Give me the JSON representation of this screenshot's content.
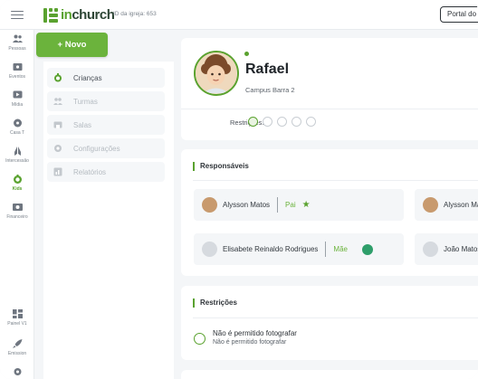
{
  "topbar": {
    "logo_text_green": "in",
    "logo_text_dark": "church",
    "church_id": "ID da igreja: 653",
    "portal_button": "Portal do Membro"
  },
  "rail": {
    "items": [
      {
        "label": "Pessoas",
        "icon": "people-icon"
      },
      {
        "label": "Eventos",
        "icon": "ticket-icon"
      },
      {
        "label": "Mídia",
        "icon": "play-icon"
      },
      {
        "label": "Casa T",
        "icon": "globe-icon"
      },
      {
        "label": "Intercessão",
        "icon": "praying-hands-icon"
      },
      {
        "label": "Kids",
        "icon": "kids-icon"
      },
      {
        "label": "Financeiro",
        "icon": "money-icon"
      },
      {
        "label": "Painel V1",
        "icon": "dashboard-icon"
      },
      {
        "label": "Emission",
        "icon": "rocket-icon"
      }
    ],
    "active": "Kids"
  },
  "actions": {
    "new_button": "+ Novo"
  },
  "submenu": {
    "items": [
      {
        "label": "Crianças"
      },
      {
        "label": "Turmas"
      },
      {
        "label": "Salas"
      },
      {
        "label": "Configurações"
      },
      {
        "label": "Relatórios"
      }
    ],
    "active": "Crianças"
  },
  "profile": {
    "name": "Rafael",
    "campus": "Campus Barra 2",
    "restrictions_label": "Restrições:"
  },
  "responsaveis": {
    "title": "Responsáveis",
    "people": [
      {
        "name": "Alysson Matos",
        "relation": "Pai"
      },
      {
        "name": "Alysson Matos",
        "relation": ""
      },
      {
        "name": "Elisabete Reinaldo Rodrigues",
        "relation": "Mãe"
      },
      {
        "name": "João Matos",
        "relation": ""
      }
    ]
  },
  "restricoes": {
    "title": "Restrições",
    "item_title": "Não é permitido fotografar",
    "item_desc": "Não é permitido fotografar"
  },
  "colors": {
    "brand_green": "#5aa22f",
    "button_green": "#6bb33c",
    "whatsapp": "#2e9e6a"
  }
}
